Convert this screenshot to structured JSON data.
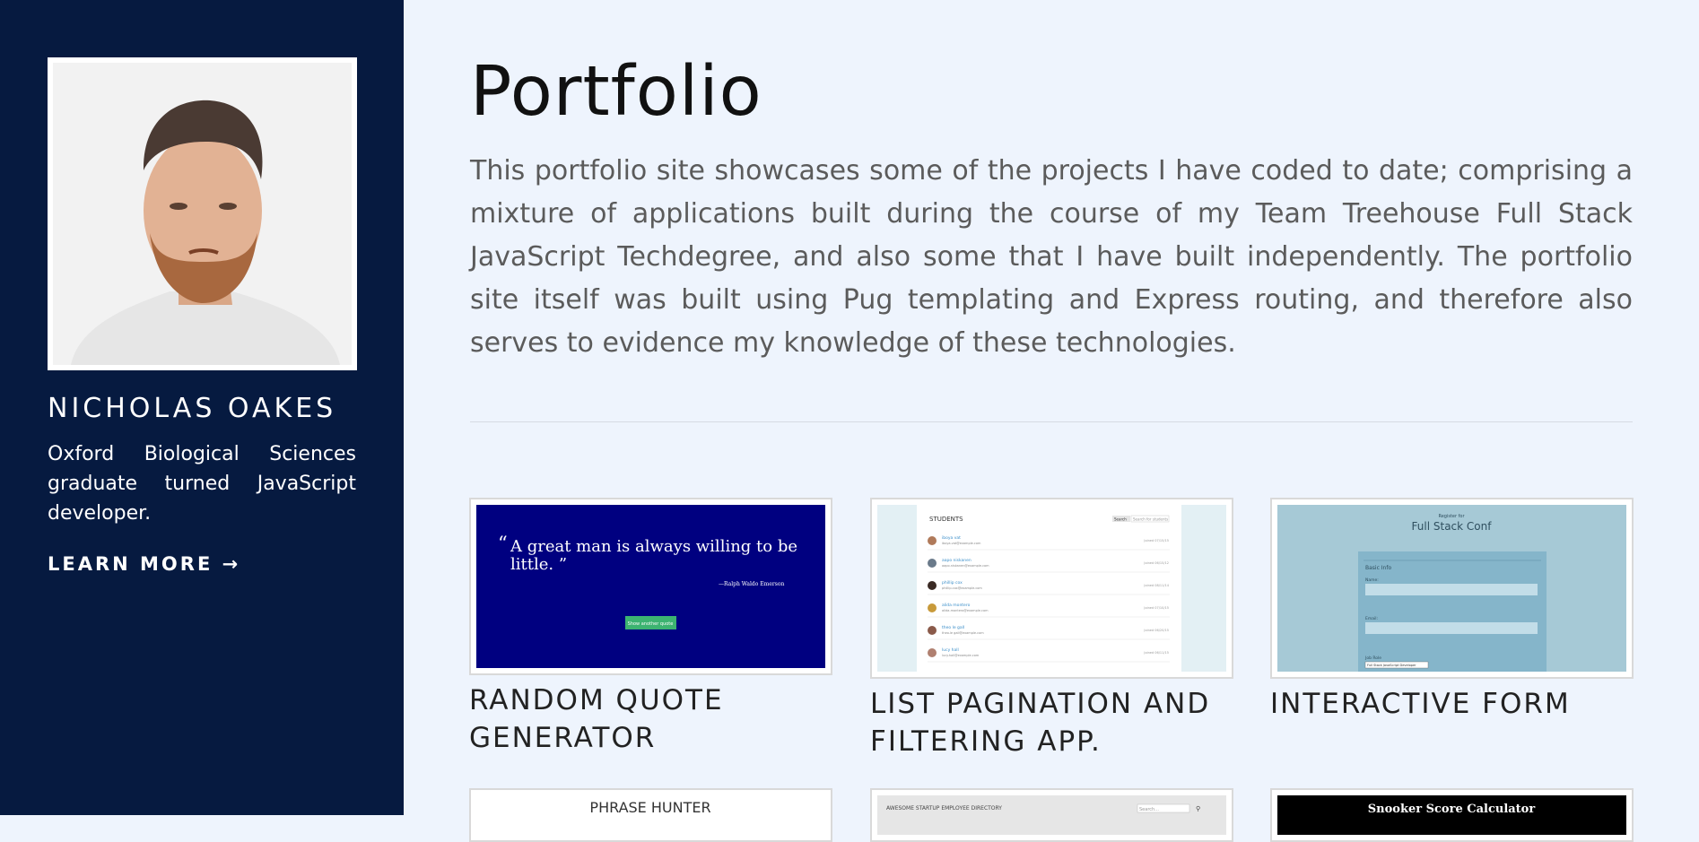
{
  "sidebar": {
    "name": "NICHOLAS OAKES",
    "bio": "Oxford Biological Sciences graduate turned JavaScript developer.",
    "learn_more": "LEARN MORE →"
  },
  "main": {
    "title": "Portfolio",
    "intro": "This portfolio site showcases some of the projects I have coded to date; comprising a mixture of applications built during the course of my Team Treehouse Full Stack JavaScript Techdegree, and also some that I have built independently. The portfolio site itself was built using Pug templating and Express routing, and therefore also serves to evidence my knowledge of these technologies."
  },
  "projects": [
    {
      "title": "RANDOM QUOTE GENERATOR",
      "thumb": {
        "quote": "A great man is always willing to be little.",
        "author": "—Ralph Waldo Emerson",
        "button": "Show another quote"
      }
    },
    {
      "title": "LIST PAGINATION AND FILTERING APP.",
      "thumb": {
        "heading": "STUDENTS",
        "search_button": "Search",
        "search_placeholder": "Search for students",
        "students": [
          {
            "name": "iboya vat",
            "email": "iboya.vat@example.com",
            "joined": "Joined 07/15/15"
          },
          {
            "name": "aapo niskanen",
            "email": "aapo.niskanen@example.com",
            "joined": "Joined 06/15/12"
          },
          {
            "name": "phillip cox",
            "email": "phillip.cox@example.com",
            "joined": "Joined 08/11/14"
          },
          {
            "name": "alida montero",
            "email": "alida.montero@example.com",
            "joined": "Joined 07/10/15"
          },
          {
            "name": "theo le gall",
            "email": "theo.le gall@example.com",
            "joined": "Joined 06/20/15"
          },
          {
            "name": "lucy hall",
            "email": "lucy.hall@example.com",
            "joined": "Joined 06/11/15"
          }
        ]
      }
    },
    {
      "title": "INTERACTIVE FORM",
      "thumb": {
        "register_for": "Register for",
        "conf": "Full Stack Conf",
        "legend": "Basic Info",
        "name_label": "Name:",
        "email_label": "Email:",
        "role_label": "Job Role",
        "role_value": "Full Stack JavaScript Developer"
      }
    },
    {
      "thumb": {
        "heading": "PHRASE HUNTER"
      }
    },
    {
      "thumb": {
        "heading": "AWESOME STARTUP EMPLOYEE DIRECTORY",
        "search_placeholder": "Search..."
      }
    },
    {
      "thumb": {
        "heading": "Snooker Score Calculator"
      }
    }
  ],
  "colors": {
    "sidebar_bg": "#061a40",
    "page_bg": "#eef4fd",
    "quote_bg": "#000080",
    "form_bg": "#a6c9d6"
  }
}
